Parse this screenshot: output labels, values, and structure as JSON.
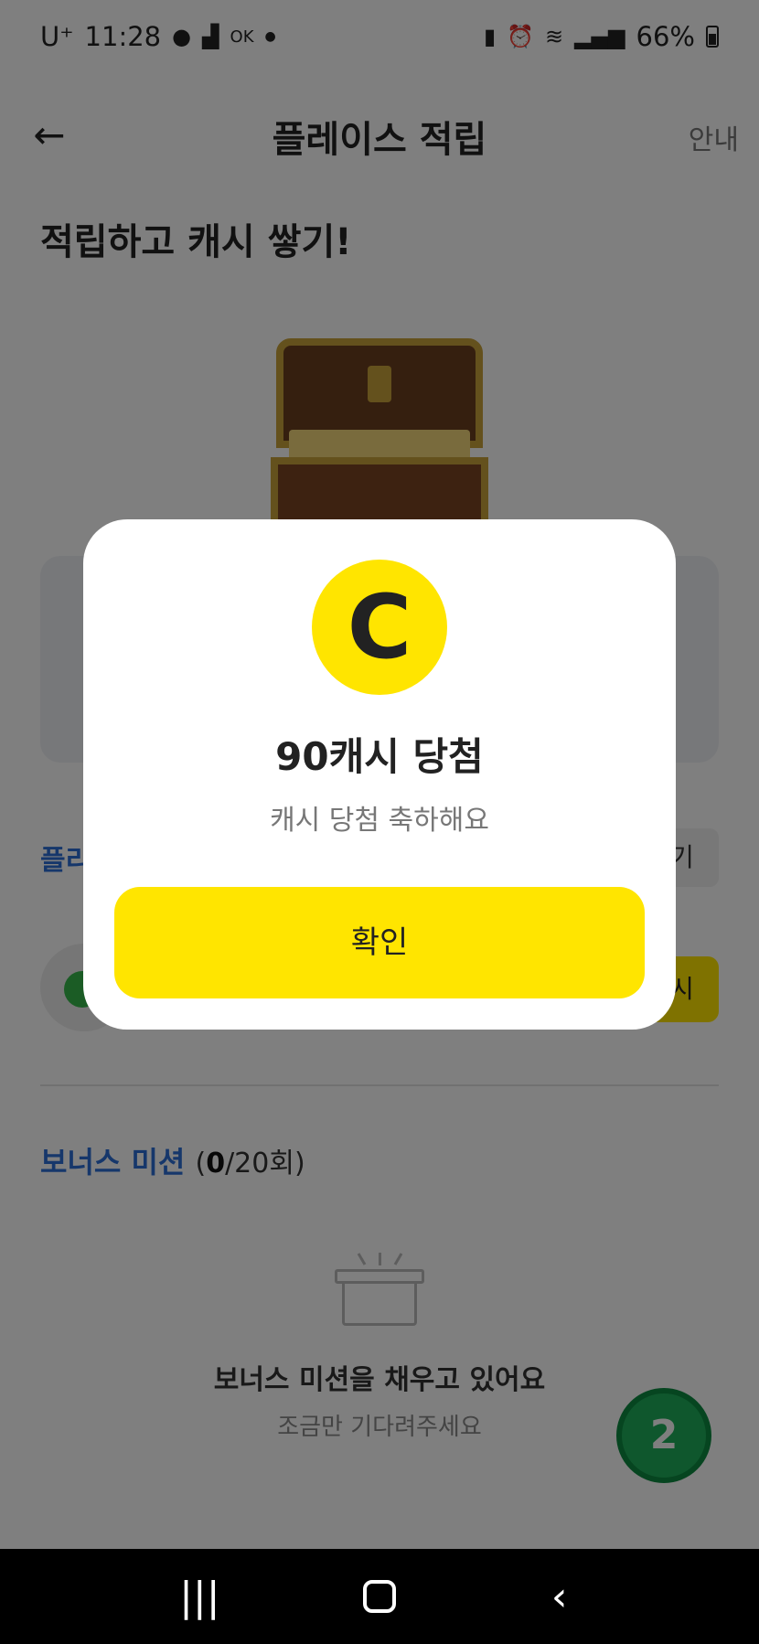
{
  "status_bar": {
    "carrier": "U⁺",
    "time": "11:28",
    "left_icons": [
      "o-icon",
      "signal-steps-icon",
      "ok-icon",
      "dot-icon"
    ],
    "battery_percent": "66%",
    "right_icons": [
      "battery-saver-icon",
      "alarm-icon",
      "wifi-icon",
      "cell-signal-icon"
    ]
  },
  "header": {
    "back_icon": "arrow-left-icon",
    "title": "플레이스 적립",
    "info_label": "안내"
  },
  "headline": "적립하고 캐시 쌓기!",
  "section": {
    "title_partial": "플리",
    "side_button_partial": "기",
    "row_button_partial": "시"
  },
  "bonus": {
    "title": "보너스 미션",
    "count_done": "0",
    "count_total": "/20회"
  },
  "empty_state": {
    "icon": "open-box-icon",
    "title": "보너스 미션을 채우고 있어요",
    "subtitle": "조금만 기다려주세요"
  },
  "floating_badge": "2",
  "modal": {
    "coin_letter": "C",
    "title": "90캐시 당첨",
    "subtitle": "캐시 당첨 축하해요",
    "confirm_label": "확인"
  },
  "nav": {
    "recent_label": "|||",
    "back_label": "‹"
  },
  "colors": {
    "accent_yellow": "#ffe500",
    "link_blue": "#2c6fd6",
    "badge_green": "#1fae5a"
  }
}
